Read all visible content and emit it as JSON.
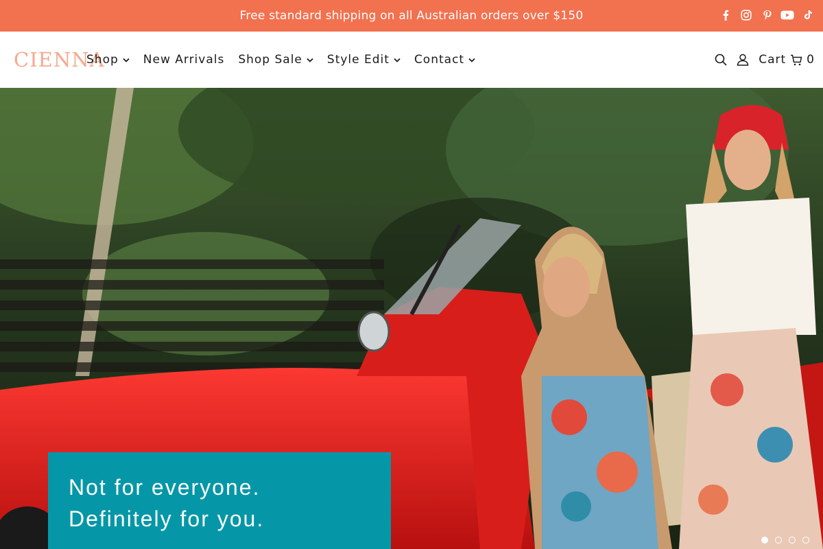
{
  "announcement": {
    "text": "Free standard shipping on all Australian orders over $150",
    "bg_color": "#f2714f",
    "social_icons": [
      "facebook-icon",
      "instagram-icon",
      "pinterest-icon",
      "youtube-icon",
      "tiktok-icon"
    ]
  },
  "header": {
    "logo": "CIENNA",
    "logo_color": "#f6a98e",
    "nav": [
      {
        "label": "Shop",
        "has_dropdown": true
      },
      {
        "label": "New Arrivals",
        "has_dropdown": false
      },
      {
        "label": "Shop Sale",
        "has_dropdown": true
      },
      {
        "label": "Style Edit",
        "has_dropdown": true
      },
      {
        "label": "Contact",
        "has_dropdown": true
      }
    ],
    "tools": {
      "search_icon": "search-icon",
      "account_icon": "user-icon",
      "cart_label": "Cart",
      "cart_icon": "cart-icon",
      "cart_count": "0"
    }
  },
  "hero": {
    "promo_line_1": "Not for everyone.",
    "promo_line_2": "Definitely for you.",
    "promo_bg": "#0597a7",
    "slide_count": 4,
    "active_slide": 1
  }
}
